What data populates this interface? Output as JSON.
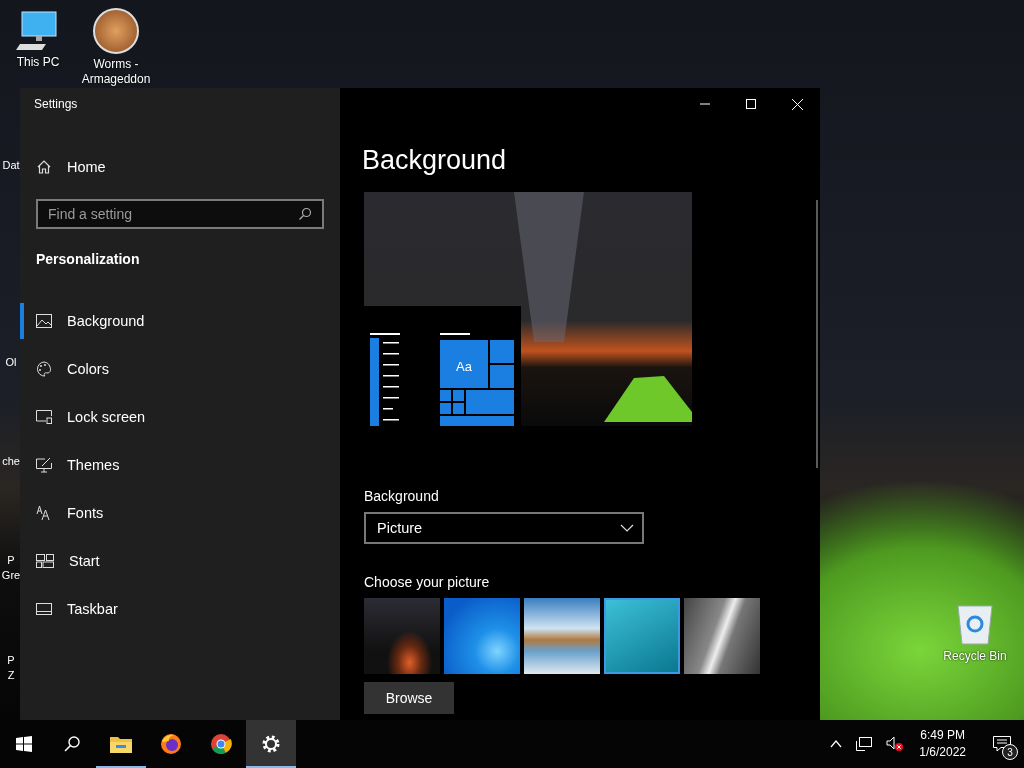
{
  "desktop": {
    "icons": [
      {
        "label": "This PC"
      },
      {
        "label": "Worms - Armageddon"
      },
      {
        "label": "Recycle Bin"
      }
    ],
    "partial_icons": [
      {
        "lines": [
          "Dat"
        ]
      },
      {
        "lines": [
          "Ol"
        ]
      },
      {
        "lines": [
          "che"
        ]
      },
      {
        "lines": [
          "P",
          "Gre"
        ]
      },
      {
        "lines": [
          "P",
          "Z"
        ]
      }
    ]
  },
  "window": {
    "title": "Settings",
    "sidebar": {
      "home": "Home",
      "search": {
        "placeholder": "Find a setting"
      },
      "section": "Personalization",
      "items": [
        {
          "label": "Background",
          "selected": true
        },
        {
          "label": "Colors",
          "selected": false
        },
        {
          "label": "Lock screen",
          "selected": false
        },
        {
          "label": "Themes",
          "selected": false
        },
        {
          "label": "Fonts",
          "selected": false
        },
        {
          "label": "Start",
          "selected": false
        },
        {
          "label": "Taskbar",
          "selected": false
        }
      ]
    },
    "page": {
      "heading": "Background",
      "preview": {
        "tile_text": "Aa"
      },
      "background_label": "Background",
      "background_dropdown": {
        "value": "Picture"
      },
      "choose_label": "Choose your picture",
      "pictures": [
        {
          "selected": false
        },
        {
          "selected": false
        },
        {
          "selected": false
        },
        {
          "selected": true
        },
        {
          "selected": false
        }
      ],
      "browse": "Browse"
    }
  },
  "taskbar": {
    "apps": [
      {
        "running": true,
        "active": false
      },
      {
        "running": false,
        "active": false
      },
      {
        "running": false,
        "active": false
      },
      {
        "running": true,
        "active": true
      }
    ],
    "volume_muted": true,
    "time": "6:49 PM",
    "date": "1/6/2022",
    "notification_count": "3"
  }
}
